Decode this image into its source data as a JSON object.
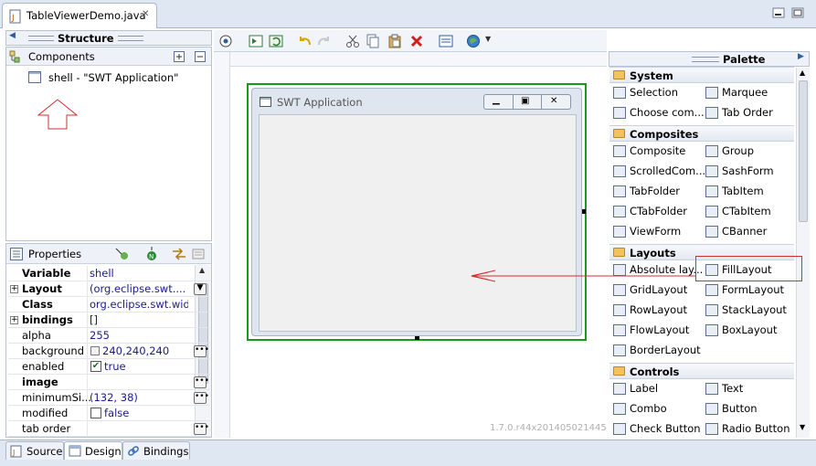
{
  "editor_tab": {
    "title": "TableViewerDemo.java",
    "close": "✕"
  },
  "structure": {
    "title": "Structure"
  },
  "components": {
    "title": "Components",
    "tree_item": "shell - \"SWT Application\""
  },
  "properties": {
    "title": "Properties",
    "rows": [
      {
        "key": "Variable",
        "value": "shell",
        "bold": true,
        "expand": false,
        "check": null,
        "swatch": false,
        "button": "none"
      },
      {
        "key": "Layout",
        "value": "(org.eclipse.swt....",
        "bold": true,
        "expand": true,
        "check": null,
        "swatch": false,
        "button": "dropdown"
      },
      {
        "key": "Class",
        "value": "org.eclipse.swt.wid...",
        "bold": true,
        "expand": false,
        "check": null,
        "swatch": false,
        "button": "none"
      },
      {
        "key": "bindings",
        "value": "[]",
        "bold": true,
        "expand": true,
        "check": null,
        "swatch": false,
        "button": "none"
      },
      {
        "key": "alpha",
        "value": "255",
        "bold": false,
        "expand": false,
        "check": null,
        "swatch": false,
        "button": "none"
      },
      {
        "key": "background",
        "value": "240,240,240",
        "bold": false,
        "expand": false,
        "check": null,
        "swatch": true,
        "button": "dots"
      },
      {
        "key": "enabled",
        "value": "true",
        "bold": false,
        "expand": false,
        "check": true,
        "swatch": false,
        "button": "none"
      },
      {
        "key": "image",
        "value": "",
        "bold": true,
        "expand": false,
        "check": null,
        "swatch": false,
        "button": "dots"
      },
      {
        "key": "minimumSi...",
        "value": "(132, 38)",
        "bold": false,
        "expand": false,
        "check": null,
        "swatch": false,
        "button": "dots"
      },
      {
        "key": "modified",
        "value": "false",
        "bold": false,
        "expand": false,
        "check": false,
        "swatch": false,
        "button": "none"
      },
      {
        "key": "tab order",
        "value": "",
        "bold": false,
        "expand": false,
        "check": null,
        "swatch": false,
        "button": "dots"
      }
    ]
  },
  "canvas": {
    "window_title": "SWT Application",
    "version": "1.7.0.r44x201405021445"
  },
  "palette": {
    "title": "Palette",
    "categories": [
      {
        "name": "System",
        "items": [
          {
            "label": "Selection",
            "icon": "arrow-cursor-icon"
          },
          {
            "label": "Marquee",
            "icon": "marquee-icon"
          },
          {
            "label": "Choose com...",
            "icon": "choose-component-icon"
          },
          {
            "label": "Tab Order",
            "icon": "tab-order-icon"
          }
        ]
      },
      {
        "name": "Composites",
        "items": [
          {
            "label": "Composite",
            "icon": "composite-icon"
          },
          {
            "label": "Group",
            "icon": "group-icon"
          },
          {
            "label": "ScrolledCom...",
            "icon": "scrolled-composite-icon"
          },
          {
            "label": "SashForm",
            "icon": "sashform-icon"
          },
          {
            "label": "TabFolder",
            "icon": "tabfolder-icon"
          },
          {
            "label": "TabItem",
            "icon": "tabitem-icon"
          },
          {
            "label": "CTabFolder",
            "icon": "ctabfolder-icon"
          },
          {
            "label": "CTabItem",
            "icon": "ctabitem-icon"
          },
          {
            "label": "ViewForm",
            "icon": "viewform-icon"
          },
          {
            "label": "CBanner",
            "icon": "cbanner-icon"
          }
        ]
      },
      {
        "name": "Layouts",
        "items": [
          {
            "label": "Absolute lay...",
            "icon": "absolute-layout-icon"
          },
          {
            "label": "FillLayout",
            "icon": "filllayout-icon"
          },
          {
            "label": "GridLayout",
            "icon": "gridlayout-icon"
          },
          {
            "label": "FormLayout",
            "icon": "formlayout-icon"
          },
          {
            "label": "RowLayout",
            "icon": "rowlayout-icon"
          },
          {
            "label": "StackLayout",
            "icon": "stacklayout-icon"
          },
          {
            "label": "FlowLayout",
            "icon": "flowlayout-icon"
          },
          {
            "label": "BoxLayout",
            "icon": "boxlayout-icon"
          },
          {
            "label": "BorderLayout",
            "icon": "borderlayout-icon"
          }
        ]
      },
      {
        "name": "Controls",
        "items": [
          {
            "label": "Label",
            "icon": "label-icon"
          },
          {
            "label": "Text",
            "icon": "text-icon"
          },
          {
            "label": "Combo",
            "icon": "combo-icon"
          },
          {
            "label": "Button",
            "icon": "button-icon"
          },
          {
            "label": "Check Button",
            "icon": "check-button-icon"
          },
          {
            "label": "Radio Button",
            "icon": "radio-button-icon"
          }
        ]
      }
    ]
  },
  "bottom_tabs": [
    {
      "label": "Source",
      "active": false
    },
    {
      "label": "Design",
      "active": true
    },
    {
      "label": "Bindings",
      "active": false
    }
  ],
  "colors": {
    "annotation": "#d03030",
    "selection": "#1a9a1a",
    "accent": "#2d5f9e"
  }
}
